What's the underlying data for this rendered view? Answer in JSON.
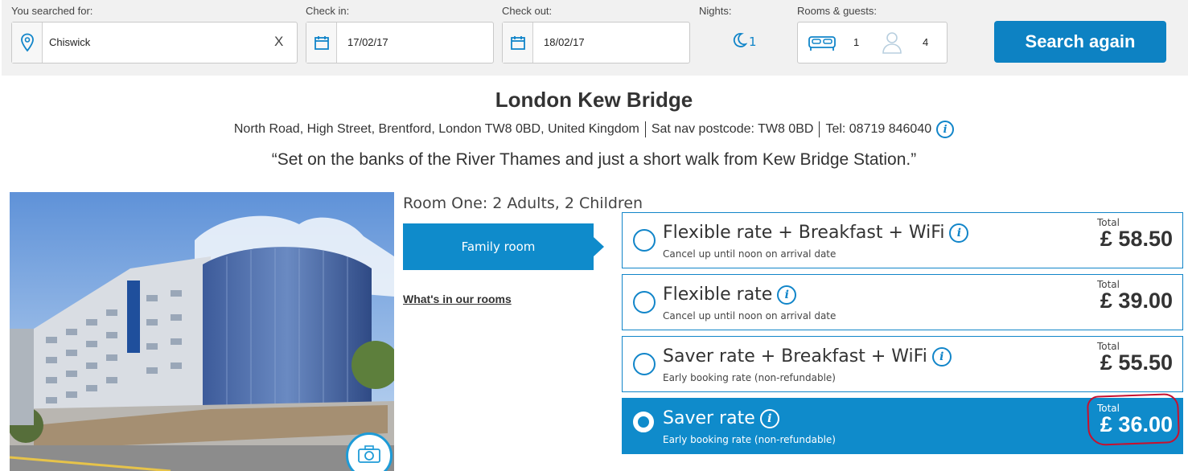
{
  "search": {
    "location_label": "You searched for:",
    "location_value": "Chiswick",
    "clear_label": "X",
    "checkin_label": "Check in:",
    "checkin_value": "17/02/17",
    "checkout_label": "Check out:",
    "checkout_value": "18/02/17",
    "nights_label": "Nights:",
    "nights_value": "1",
    "rooms_guests_label": "Rooms & guests:",
    "rooms_value": "1",
    "guests_value": "4",
    "button_label": "Search again",
    "icons": [
      "location-pin-icon",
      "calendar-icon",
      "moon-icon",
      "bed-icon",
      "person-icon"
    ]
  },
  "hotel": {
    "name": "London Kew Bridge",
    "address": "North Road, High Street, Brentford, London TW8 0BD, United Kingdom",
    "sat_nav": "Sat nav postcode: TW8 0BD",
    "tel": "Tel: 08719 846040",
    "info_glyph": "i",
    "quote": "“Set on the banks of the River Thames and just a short walk from Kew Bridge Station.”"
  },
  "room": {
    "title": "Room One: 2 Adults, 2 Children",
    "tab_label": "Family room",
    "link_label": "What's in our rooms",
    "rates": [
      {
        "name": "Flexible rate + Breakfast + WiFi",
        "sub": "Cancel up until noon on arrival date",
        "total_label": "Total",
        "price": "£ 58.50",
        "selected": false
      },
      {
        "name": "Flexible rate",
        "sub": "Cancel up until noon on arrival date",
        "total_label": "Total",
        "price": "£ 39.00",
        "selected": false
      },
      {
        "name": "Saver rate + Breakfast + WiFi",
        "sub": "Early booking rate (non-refundable)",
        "total_label": "Total",
        "price": "£ 55.50",
        "selected": false
      },
      {
        "name": "Saver rate",
        "sub": "Early booking rate (non-refundable)",
        "total_label": "Total",
        "price": "£ 36.00",
        "selected": true
      }
    ]
  },
  "colors": {
    "brand_blue": "#0f8bcb",
    "button_blue": "#0d82c3",
    "annotation_red": "#c8102e",
    "search_bg": "#f1f1f1"
  }
}
